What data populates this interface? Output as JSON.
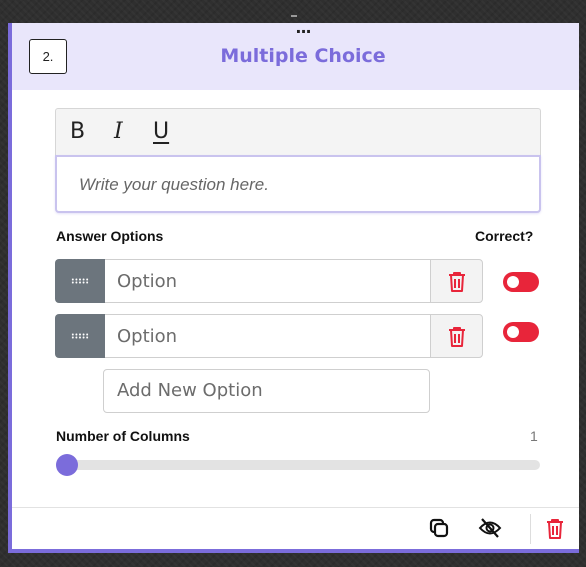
{
  "question": {
    "number": "2.",
    "title": "Multiple Choice",
    "menu_dots": "...",
    "placeholder": "Write your question here."
  },
  "toolbar": {
    "bold_label": "B",
    "italic_label": "I",
    "underline_label": "U"
  },
  "answers": {
    "section_label": "Answer Options",
    "correct_label": "Correct?",
    "options": [
      {
        "placeholder": "Option",
        "correct": false
      },
      {
        "placeholder": "Option",
        "correct": false
      }
    ],
    "add_placeholder": "Add New Option"
  },
  "columns": {
    "label": "Number of Columns",
    "value": "1",
    "slider_value": 1
  },
  "icons": {
    "drag": "drag-handle-icon",
    "trash": "trash-icon",
    "duplicate": "duplicate-icon",
    "hide": "eye-slash-icon"
  },
  "colors": {
    "accent": "#7b6cdb",
    "header_bg": "#e9e6fb",
    "danger": "#e8253a",
    "drag_handle": "#6c757d"
  }
}
